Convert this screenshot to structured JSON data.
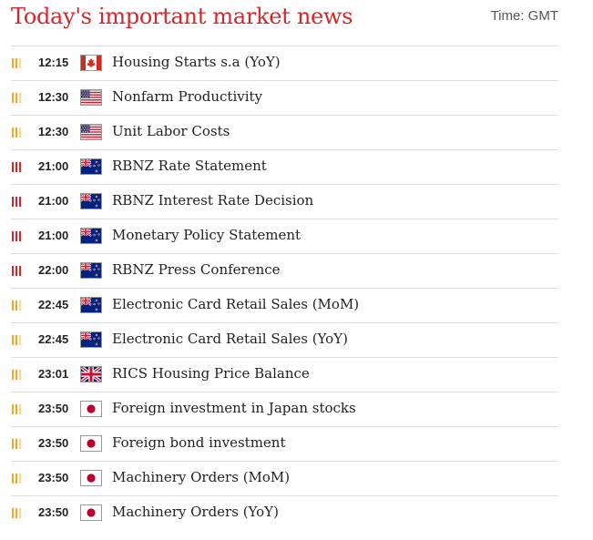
{
  "header": {
    "title": "Today's important market news",
    "timezone_label": "Time: GMT"
  },
  "colors": {
    "title_red": "#d0282c",
    "importance_high": "#d0282c",
    "importance_medium": "#f5a623",
    "importance_inactive": "#f7d9a0"
  },
  "events": [
    {
      "importance": 2,
      "time": "12:15",
      "flag": "canada-flag-icon",
      "name": "Housing Starts s.a (YoY)"
    },
    {
      "importance": 2,
      "time": "12:30",
      "flag": "usa-flag-icon",
      "name": "Nonfarm Productivity"
    },
    {
      "importance": 2,
      "time": "12:30",
      "flag": "usa-flag-icon",
      "name": "Unit Labor Costs"
    },
    {
      "importance": 3,
      "time": "21:00",
      "flag": "new-zealand-flag-icon",
      "name": "RBNZ Rate Statement"
    },
    {
      "importance": 3,
      "time": "21:00",
      "flag": "new-zealand-flag-icon",
      "name": "RBNZ Interest Rate Decision"
    },
    {
      "importance": 3,
      "time": "21:00",
      "flag": "new-zealand-flag-icon",
      "name": "Monetary Policy Statement"
    },
    {
      "importance": 3,
      "time": "22:00",
      "flag": "new-zealand-flag-icon",
      "name": "RBNZ Press Conference"
    },
    {
      "importance": 2,
      "time": "22:45",
      "flag": "new-zealand-flag-icon",
      "name": "Electronic Card Retail Sales (MoM)"
    },
    {
      "importance": 2,
      "time": "22:45",
      "flag": "new-zealand-flag-icon",
      "name": "Electronic Card Retail Sales (YoY)"
    },
    {
      "importance": 2,
      "time": "23:01",
      "flag": "uk-flag-icon",
      "name": "RICS Housing Price Balance"
    },
    {
      "importance": 2,
      "time": "23:50",
      "flag": "japan-flag-icon",
      "name": "Foreign investment in Japan stocks"
    },
    {
      "importance": 2,
      "time": "23:50",
      "flag": "japan-flag-icon",
      "name": "Foreign bond investment"
    },
    {
      "importance": 2,
      "time": "23:50",
      "flag": "japan-flag-icon",
      "name": "Machinery Orders (MoM)"
    },
    {
      "importance": 2,
      "time": "23:50",
      "flag": "japan-flag-icon",
      "name": "Machinery Orders (YoY)"
    }
  ]
}
